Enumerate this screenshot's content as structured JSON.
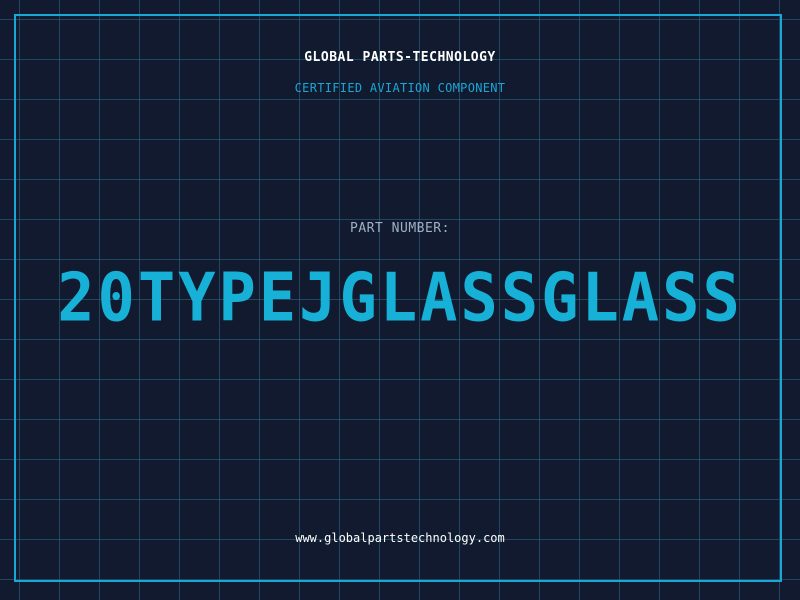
{
  "header": {
    "company": "GLOBAL PARTS-TECHNOLOGY",
    "subtitle": "CERTIFIED AVIATION COMPONENT"
  },
  "part": {
    "label": "PART NUMBER:",
    "number": "20TYPEJGLASSGLASS"
  },
  "footer": {
    "website": "www.globalpartstechnology.com"
  },
  "colors": {
    "background": "#111a2e",
    "grid": "#286e8c",
    "accent": "#17b1d8",
    "border": "#1aa6d6"
  }
}
